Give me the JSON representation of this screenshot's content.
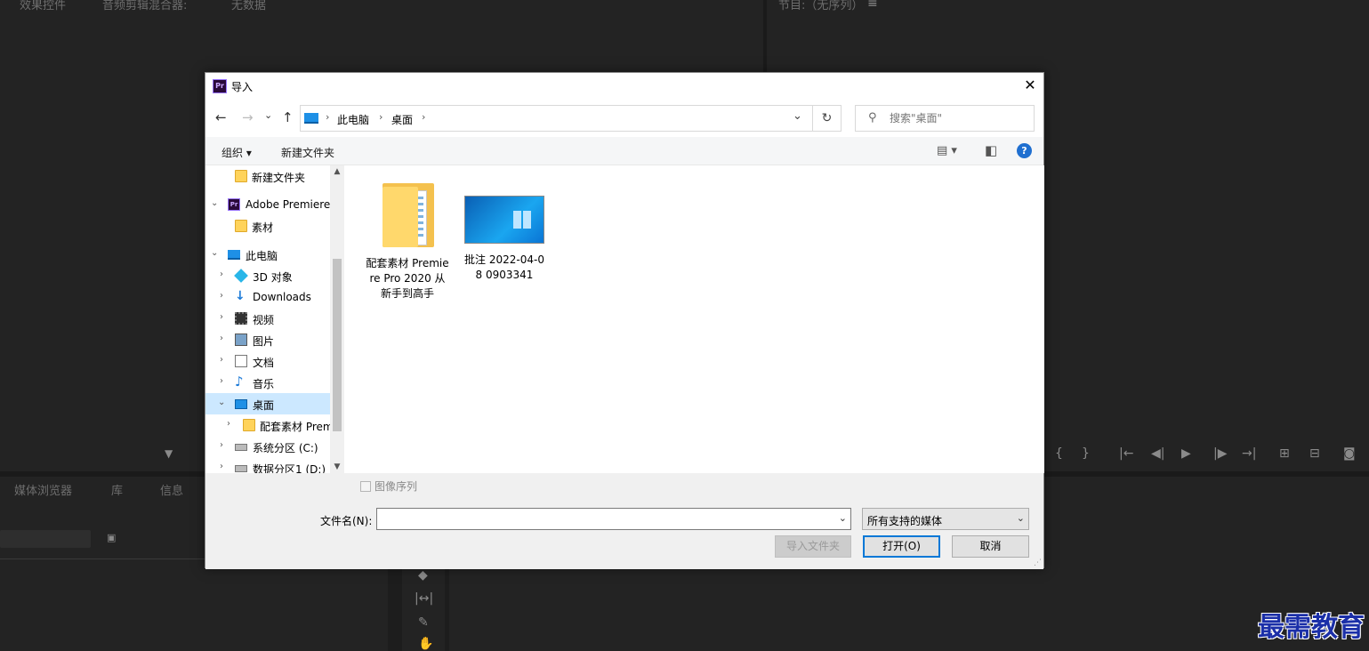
{
  "background": {
    "top_left_tabs": [
      "效果控件",
      "音频剪辑混合器:",
      "无数据"
    ],
    "top_right_title": "节目:（无序列）",
    "bottom_left_tabs": [
      "媒体浏览器",
      "库",
      "信息"
    ]
  },
  "dialog": {
    "title": "导入",
    "close_glyph": "✕",
    "nav": {
      "back": "←",
      "forward": "→",
      "recent": "⌄",
      "up": "↑"
    },
    "address": {
      "segments": [
        "此电脑",
        "桌面"
      ],
      "separator": "›"
    },
    "refresh_glyph": "↻",
    "search_placeholder": "搜索\"桌面\"",
    "toolbar": {
      "organize": "组织 ▾",
      "new_folder": "新建文件夹",
      "view_glyph": "▤ ▾",
      "pane_glyph": "◧",
      "help_glyph": "?"
    },
    "tree": [
      {
        "label": "新建文件夹",
        "icon": "folder-icon",
        "arrow": ""
      },
      {
        "label": "Adobe Premiere",
        "icon": "premiere-icon",
        "arrow": "⌄"
      },
      {
        "label": "素材",
        "icon": "folder-icon",
        "arrow": ""
      },
      {
        "label": "此电脑",
        "icon": "computer-icon",
        "arrow": "⌄"
      },
      {
        "label": "3D 对象",
        "icon": "cube-icon",
        "arrow": "›"
      },
      {
        "label": "Downloads",
        "icon": "download-icon",
        "arrow": "›"
      },
      {
        "label": "视频",
        "icon": "video-icon",
        "arrow": "›"
      },
      {
        "label": "图片",
        "icon": "picture-icon",
        "arrow": "›"
      },
      {
        "label": "文档",
        "icon": "document-icon",
        "arrow": "›"
      },
      {
        "label": "音乐",
        "icon": "music-icon",
        "arrow": "›"
      },
      {
        "label": "桌面",
        "icon": "desktop-icon",
        "arrow": "⌄"
      },
      {
        "label": "配套素材 Prem",
        "icon": "folder-icon",
        "arrow": "›"
      },
      {
        "label": "系统分区 (C:)",
        "icon": "drive-icon",
        "arrow": "›"
      },
      {
        "label": "数据分区1 (D:)",
        "icon": "drive-icon",
        "arrow": "›"
      }
    ],
    "files": [
      {
        "label": "配套素材 Premiere Pro 2020 从新手到高手",
        "type": "folder"
      },
      {
        "label": "批注 2022-04-08 0903341",
        "type": "image"
      }
    ],
    "image_sequence_label": "图像序列",
    "filename_label": "文件名(N):",
    "filename_value": "",
    "filetype_value": "所有支持的媒体",
    "buttons": {
      "import_folder": "导入文件夹",
      "open": "打开(O)",
      "cancel": "取消"
    }
  },
  "watermark": "最需教育"
}
